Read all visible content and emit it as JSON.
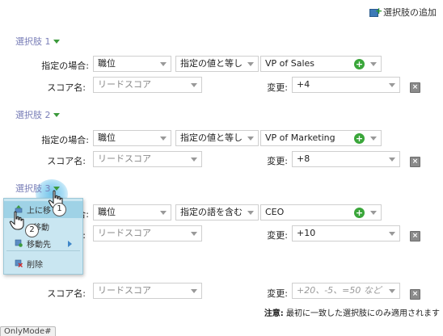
{
  "header": {
    "add_choice_label": "選択肢の追加"
  },
  "labels": {
    "condition": "指定の場合:",
    "score_name": "スコア名:",
    "change": "変更:"
  },
  "choices": [
    {
      "title": "選択肢 1",
      "field": "職位",
      "operator": "指定の値と等し",
      "value": "VP of Sales",
      "score_name": "リードスコア",
      "change": "+4"
    },
    {
      "title": "選択肢 2",
      "field": "職位",
      "operator": "指定の値と等し",
      "value": "VP of Marketing",
      "score_name": "リードスコア",
      "change": "+8"
    },
    {
      "title": "選択肢 3",
      "field": "職位",
      "operator": "指定の語を含む",
      "value": "CEO",
      "score_name": "リードスコア",
      "change": "+10"
    }
  ],
  "default_row": {
    "score_name": "リードスコア",
    "change_placeholder": "+20、-5、=50 など"
  },
  "context_menu": {
    "items": [
      {
        "label": "上に移",
        "icon": "move-up-icon"
      },
      {
        "label": "移動",
        "icon": "move-icon"
      },
      {
        "label": "移動先",
        "icon": "move-to-icon"
      },
      {
        "label": "削除",
        "icon": "delete-icon"
      }
    ]
  },
  "annotations": {
    "step1": "1",
    "step2": "2"
  },
  "footer": {
    "note_prefix": "注意:",
    "note_text": " 最初に一致した選択肢にのみ適用されます",
    "tab_label": "OnlyMode#"
  },
  "colors": {
    "accent_green": "#3aa63a",
    "menu_bg": "#c9e6f1",
    "title_purple": "#7a7fb8"
  }
}
